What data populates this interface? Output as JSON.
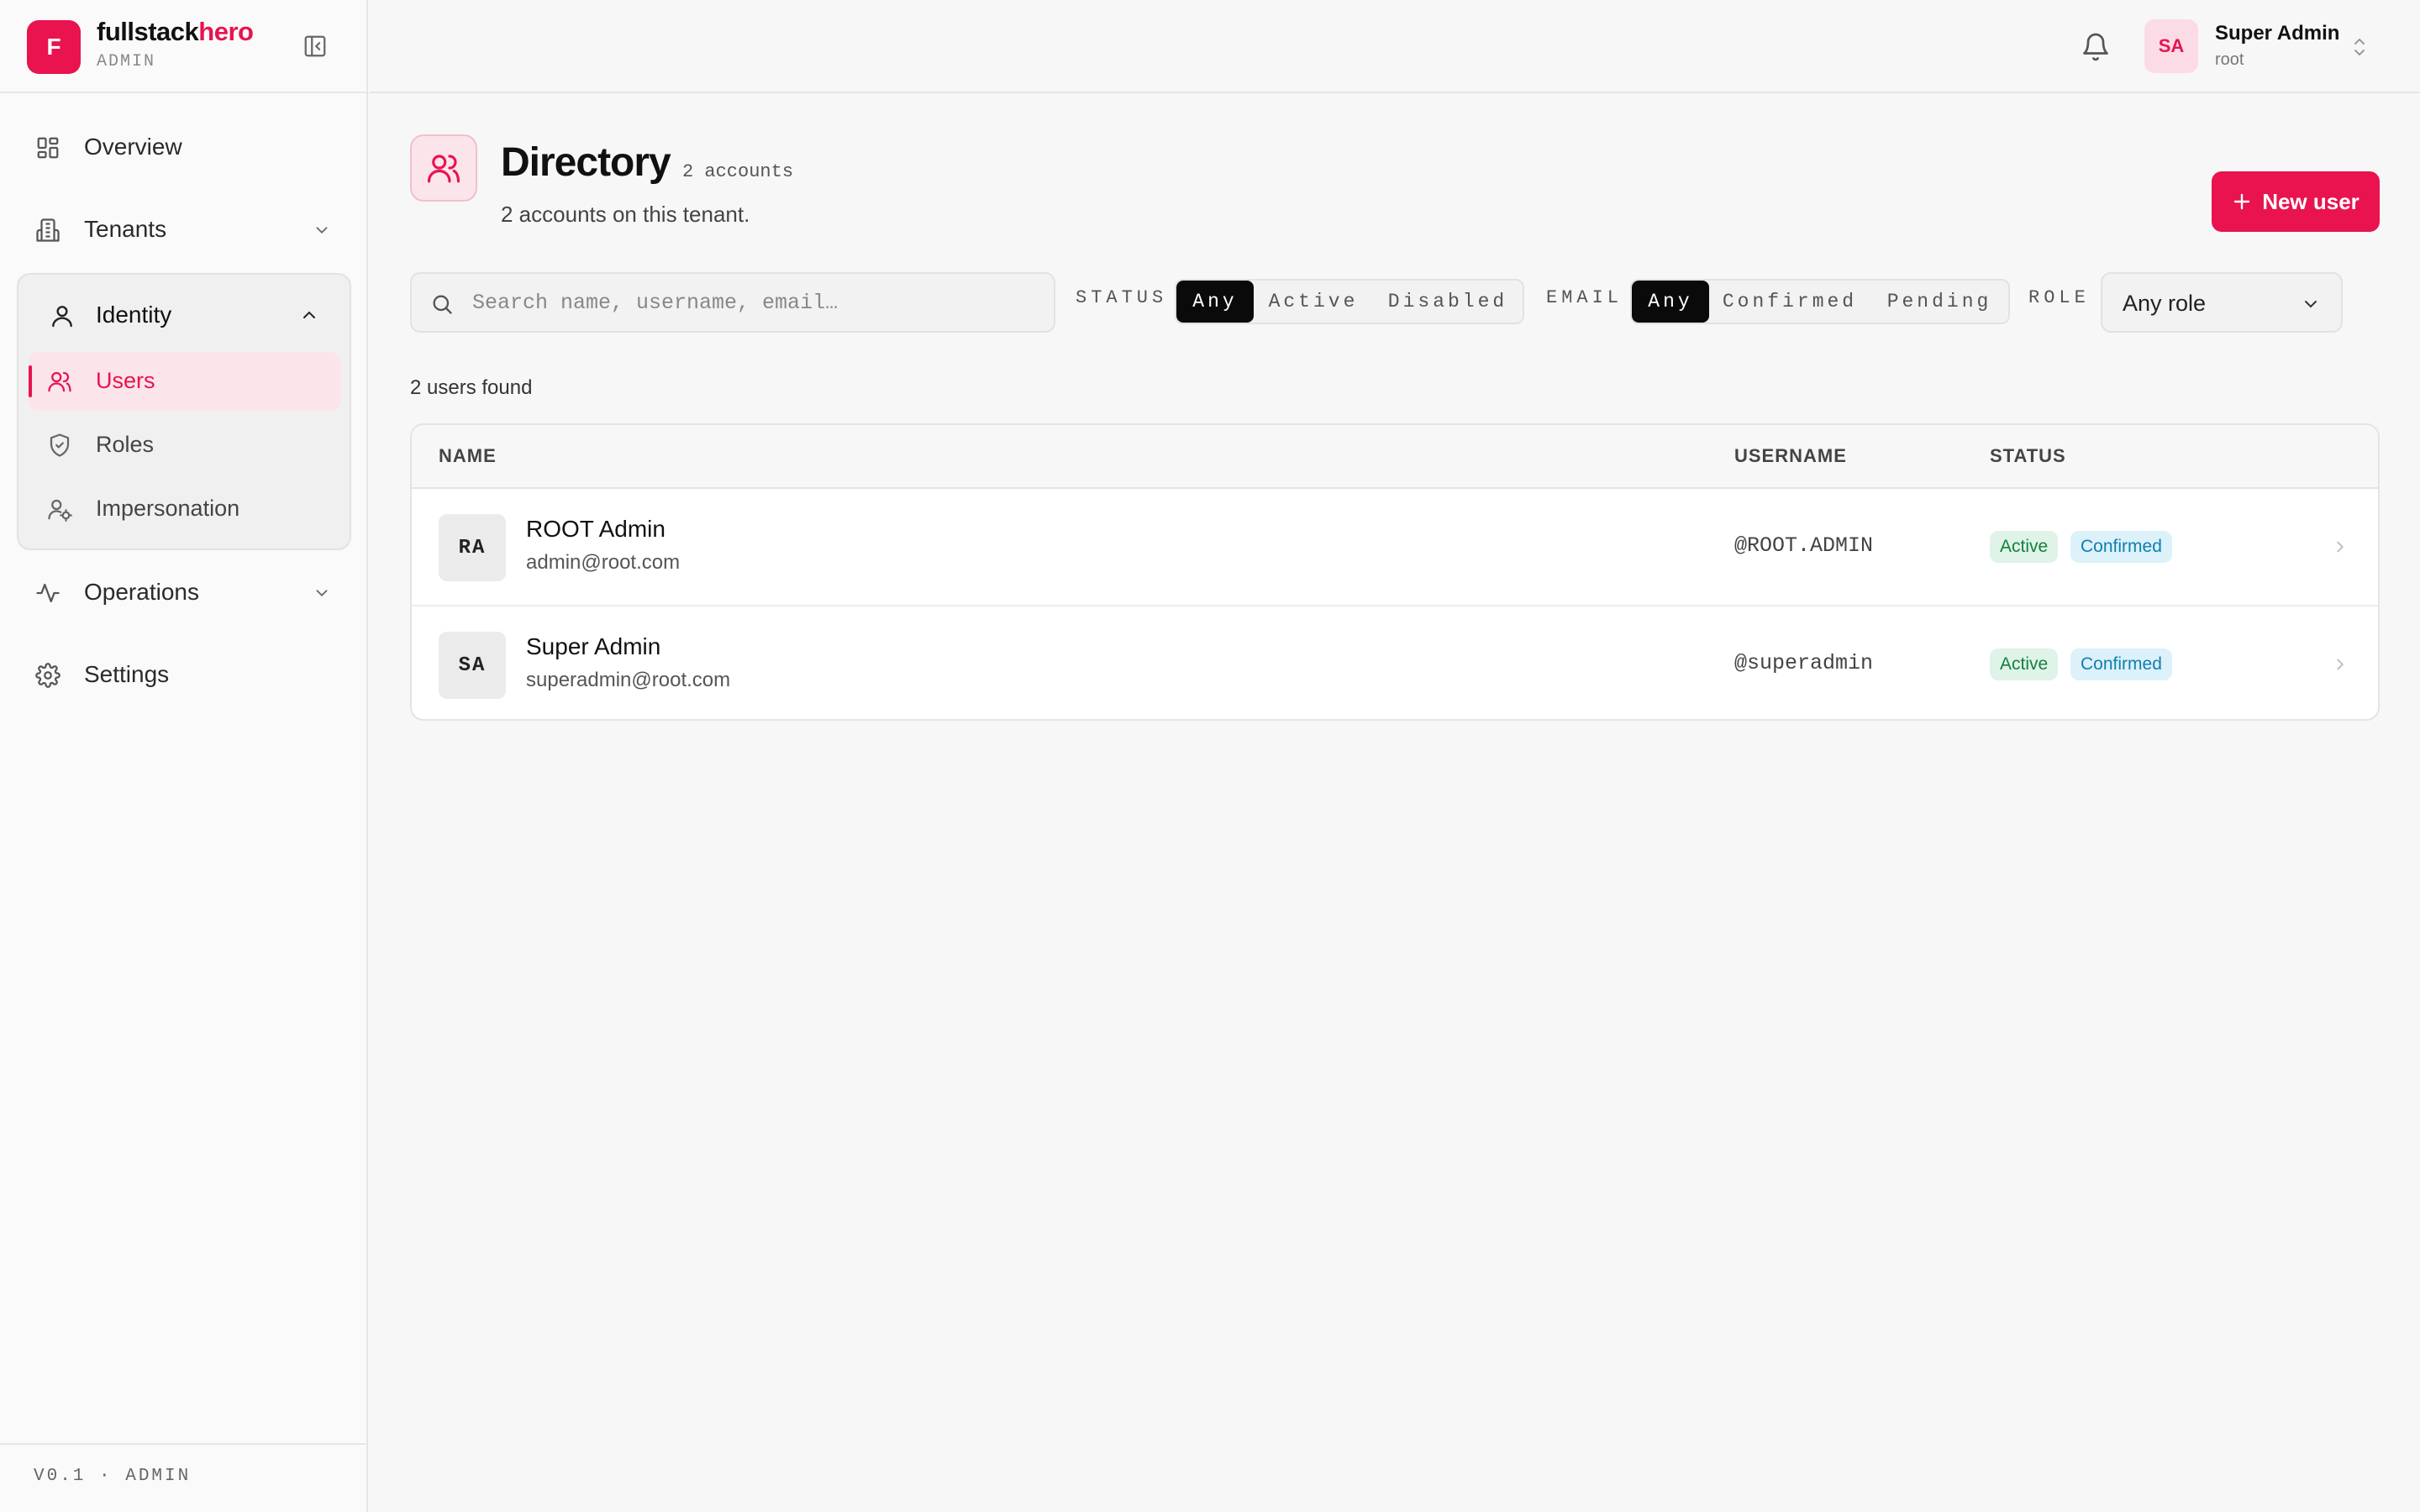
{
  "brand": {
    "name_part1": "fullstack",
    "name_part2": "hero",
    "sub": "ADMIN",
    "logo_letter": "F"
  },
  "nav": {
    "overview": "Overview",
    "tenants": "Tenants",
    "identity": "Identity",
    "identity_items": [
      "Users",
      "Roles",
      "Impersonation"
    ],
    "operations": "Operations",
    "settings": "Settings"
  },
  "footer": {
    "version": "V0.1 · ADMIN"
  },
  "user": {
    "initials": "SA",
    "name": "Super Admin",
    "tenant": "root"
  },
  "page": {
    "title": "Directory",
    "count": "2 accounts",
    "subtitle": "2 accounts on this tenant.",
    "new_user": "New user"
  },
  "filters": {
    "search_placeholder": "Search name, username, email…",
    "status_label": "STATUS",
    "status_options": [
      "Any",
      "Active",
      "Disabled"
    ],
    "status_selected": "Any",
    "email_label": "EMAIL",
    "email_options": [
      "Any",
      "Confirmed",
      "Pending"
    ],
    "email_selected": "Any",
    "role_label": "ROLE",
    "role_value": "Any role"
  },
  "results": {
    "count_text": "2 users found"
  },
  "table": {
    "columns": [
      "NAME",
      "USERNAME",
      "STATUS"
    ],
    "rows": [
      {
        "initials": "RA",
        "name": "ROOT Admin",
        "email": "admin@root.com",
        "username": "@ROOT.ADMIN",
        "status": "Active",
        "email_status": "Confirmed"
      },
      {
        "initials": "SA",
        "name": "Super Admin",
        "email": "superadmin@root.com",
        "username": "@superadmin",
        "status": "Active",
        "email_status": "Confirmed"
      }
    ]
  },
  "colors": {
    "accent": "#e8134f",
    "active_badge": "#15803d",
    "confirmed_badge": "#0e7fb0"
  }
}
